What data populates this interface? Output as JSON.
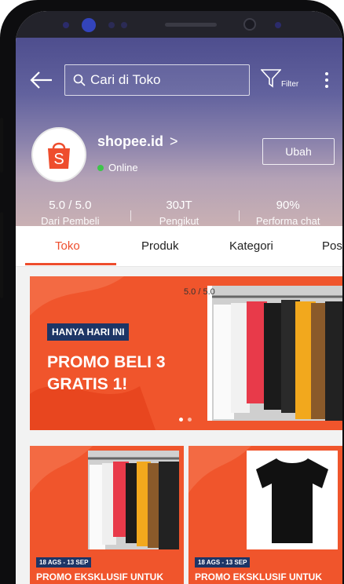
{
  "header": {
    "search_placeholder": "Cari di Toko",
    "filter_label": "Filter"
  },
  "shop": {
    "name": "shopee.id",
    "chevron": ">",
    "status": "Online",
    "edit_button": "Ubah"
  },
  "stats": [
    {
      "value": "5.0 / 5.0",
      "label": "Dari Pembeli"
    },
    {
      "value": "30JT",
      "label": "Pengikut"
    },
    {
      "value": "90%",
      "label": "Performa chat"
    }
  ],
  "tabs": [
    "Toko",
    "Produk",
    "Kategori",
    "Post"
  ],
  "banner": {
    "badge": "HANYA HARI INI",
    "title": "PROMO BELI 3 GRATIS 1!",
    "rating_overlay": "5.0 / 5.0"
  },
  "cards": [
    {
      "date": "18 AGS - 13 SEP",
      "title": "PROMO EKSKLUSIF UNTUK PRODUK TERLARIS"
    },
    {
      "date": "18 AGS - 13 SEP",
      "title": "PROMO EKSKLUSIF UNTUK PRODUK TERLARIS"
    }
  ],
  "colors": {
    "brand": "#ee4d2d",
    "banner": "#f0552c",
    "badge": "#1d3566"
  }
}
